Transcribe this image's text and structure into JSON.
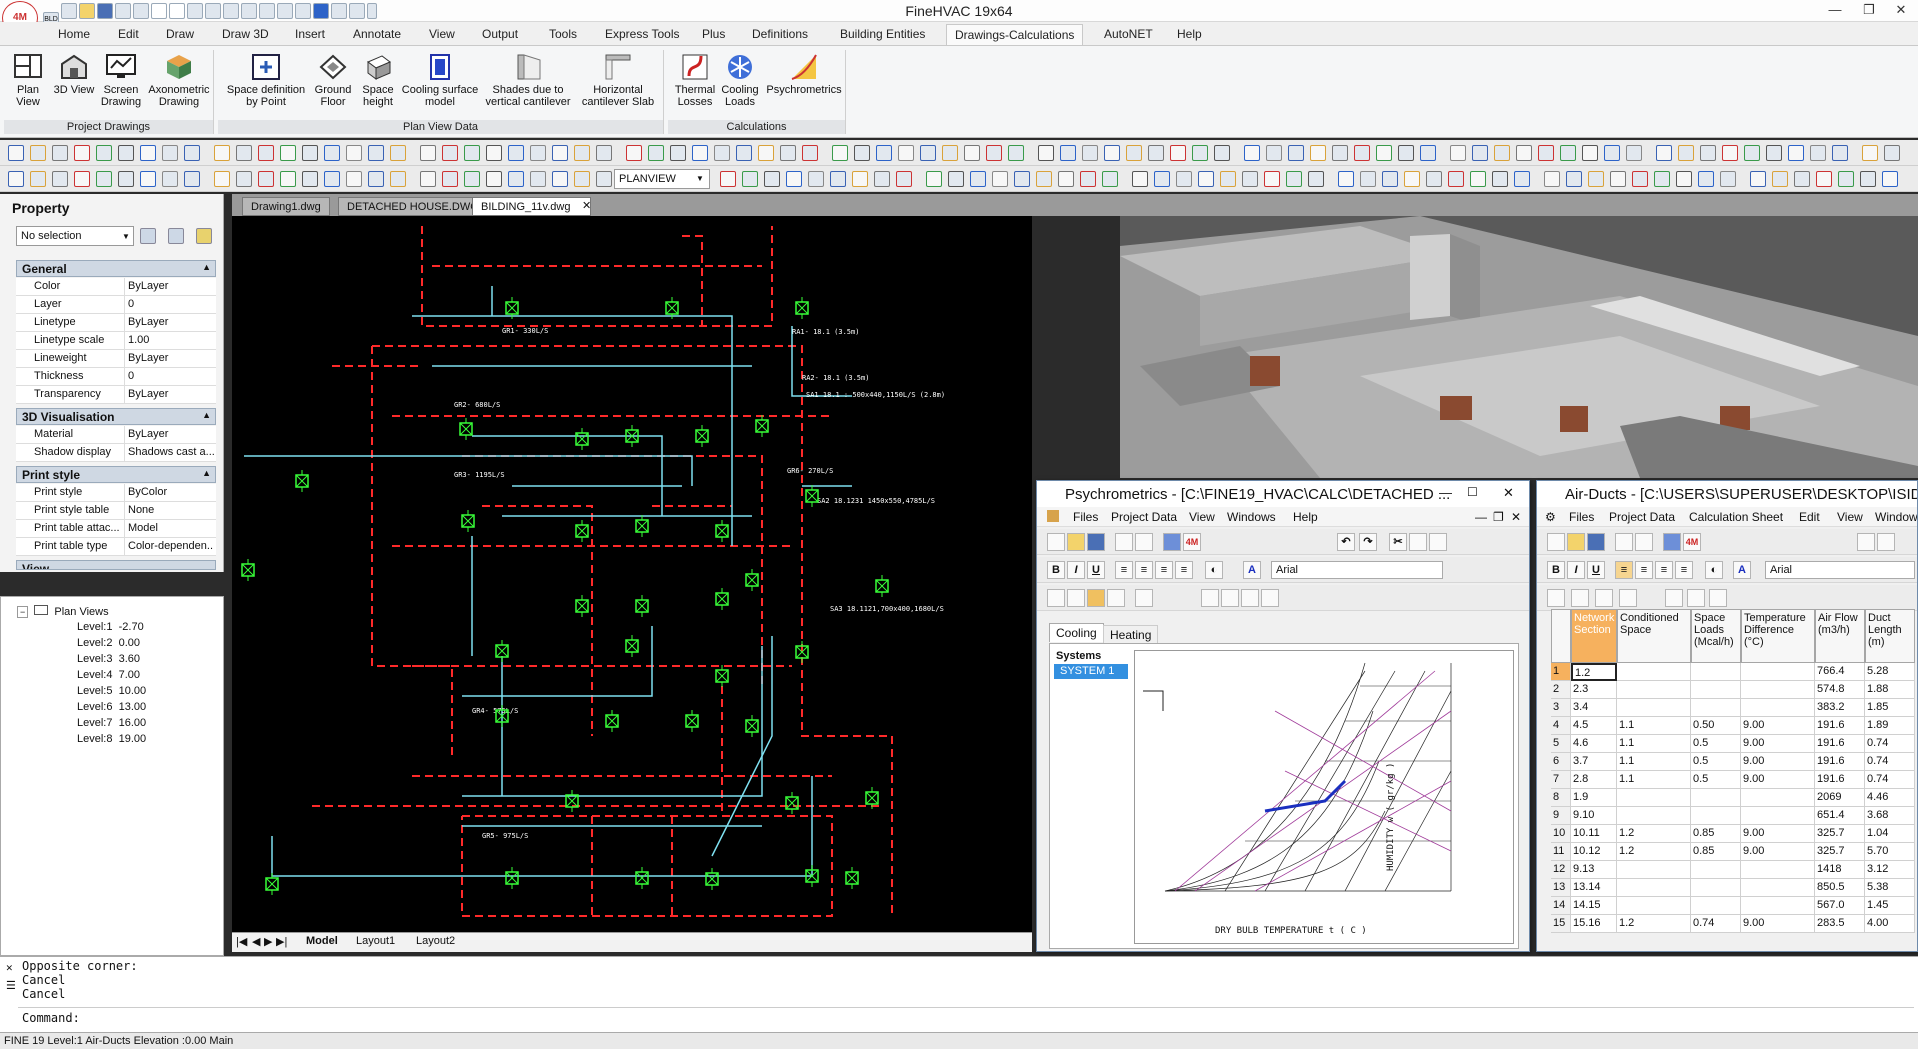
{
  "app": {
    "title": "FineHVAC 19x64",
    "logo": "4M",
    "qat_label": "BLD"
  },
  "ribbon_tabs": [
    "Home",
    "Edit",
    "Draw",
    "Draw 3D",
    "Insert",
    "Annotate",
    "View",
    "Output",
    "Tools",
    "Express Tools",
    "Plus",
    "Definitions",
    "Building Entities",
    "Drawings-Calculations",
    "AutoNET",
    "Help"
  ],
  "ribbon": {
    "groups": [
      {
        "label": "Project Drawings",
        "buttons": [
          "Plan View",
          "3D View",
          "Screen Drawing",
          "Axonometric Drawing"
        ]
      },
      {
        "label": "Plan View Data",
        "buttons": [
          "Space definition by Point",
          "Ground Floor",
          "Space height",
          "Cooling surface model",
          "Shades due to vertical cantilever",
          "Horizontal cantilever Slab"
        ]
      },
      {
        "label": "Calculations",
        "buttons": [
          "Thermal Losses",
          "Cooling Loads",
          "Psychrometrics"
        ]
      }
    ]
  },
  "toolbar": {
    "planview_value": "PLANVIEW"
  },
  "doc_tabs": [
    "Drawing1.dwg",
    "DETACHED HOUSE.DWG",
    "BILDING_11v.dwg"
  ],
  "property_panel": {
    "title": "Property",
    "selection": "No selection",
    "sections": [
      {
        "name": "General",
        "rows": [
          [
            "Color",
            "ByLayer"
          ],
          [
            "Layer",
            "0"
          ],
          [
            "Linetype",
            "ByLayer"
          ],
          [
            "Linetype scale",
            "1.00"
          ],
          [
            "Lineweight",
            "ByLayer"
          ],
          [
            "Thickness",
            "0"
          ],
          [
            "Transparency",
            "ByLayer"
          ]
        ]
      },
      {
        "name": "3D Visualisation",
        "rows": [
          [
            "Material",
            "ByLayer"
          ],
          [
            "Shadow display",
            "Shadows cast a..."
          ]
        ]
      },
      {
        "name": "Print style",
        "rows": [
          [
            "Print style",
            "ByColor"
          ],
          [
            "Print style table",
            "None"
          ],
          [
            "Print table attac...",
            "Model"
          ],
          [
            "Print table type",
            "Color-dependen..."
          ]
        ]
      }
    ],
    "collapsed_section": "View"
  },
  "plan_views": {
    "root": "Plan Views",
    "levels": [
      [
        "Level:1",
        "-2.70"
      ],
      [
        "Level:2",
        "0.00"
      ],
      [
        "Level:3",
        "3.60"
      ],
      [
        "Level:4",
        "7.00"
      ],
      [
        "Level:5",
        "10.00"
      ],
      [
        "Level:6",
        "13.00"
      ],
      [
        "Level:7",
        "16.00"
      ],
      [
        "Level:8",
        "19.00"
      ]
    ]
  },
  "layout_tabs": [
    "Model",
    "Layout1",
    "Layout2"
  ],
  "cad_labels": {
    "ra": "RA1- 18.1 (3.5m)",
    "ra2": "RA2- 18.1 (3.5m)",
    "sa1": "SA1 18.1 : 500x440,1150L/S (2.8m)",
    "sa2": "SA2 18.1231 1450x550,4785L/S",
    "sa3": "SA3 18.1121,700x400,1680L/S",
    "g1": "GR1- 330L/S",
    "g2": "GR2- 680L/S",
    "g3": "GR3- 1195L/S",
    "g4": "GR4- 575L/S",
    "g5": "GR5- 975L/S",
    "g6": "GR6- 270L/S"
  },
  "psychrometrics": {
    "title": "Psychrometrics - [C:\\FINE19_HVAC\\CALC\\DETACHED ...",
    "menu": [
      "Files",
      "Project Data",
      "View",
      "Windows",
      "Help"
    ],
    "font": "Arial",
    "tabs": [
      "Cooling",
      "Heating"
    ],
    "systems_label": "Systems",
    "system": "SYSTEM 1",
    "xlabel": "DRY BULB TEMPERATURE  t ( C )",
    "ylabel": "HUMIDITY w ( gr/kg )"
  },
  "air_ducts": {
    "title": "Air-Ducts - [C:\\USERS\\SUPERUSER\\DESKTOP\\ISIDOR",
    "menu": [
      "Files",
      "Project Data",
      "Calculation Sheet",
      "Edit",
      "View",
      "Window"
    ],
    "font": "Arial",
    "columns": [
      "Network Section",
      "Conditioned Space",
      "Space Loads (Mcal/h)",
      "Temperature Difference (°C)",
      "Air Flow (m3/h)",
      "Duct Length (m)"
    ],
    "rows": [
      [
        "1",
        "1.2",
        "",
        "",
        "",
        "766.4",
        "5.28"
      ],
      [
        "2",
        "2.3",
        "",
        "",
        "",
        "574.8",
        "1.88"
      ],
      [
        "3",
        "3.4",
        "",
        "",
        "",
        "383.2",
        "1.85"
      ],
      [
        "4",
        "4.5",
        "1.1",
        "0.50",
        "9.00",
        "191.6",
        "1.89"
      ],
      [
        "5",
        "4.6",
        "1.1",
        "0.5",
        "9.00",
        "191.6",
        "0.74"
      ],
      [
        "6",
        "3.7",
        "1.1",
        "0.5",
        "9.00",
        "191.6",
        "0.74"
      ],
      [
        "7",
        "2.8",
        "1.1",
        "0.5",
        "9.00",
        "191.6",
        "0.74"
      ],
      [
        "8",
        "1.9",
        "",
        "",
        "",
        "2069",
        "4.46"
      ],
      [
        "9",
        "9.10",
        "",
        "",
        "",
        "651.4",
        "3.68"
      ],
      [
        "10",
        "10.11",
        "1.2",
        "0.85",
        "9.00",
        "325.7",
        "1.04"
      ],
      [
        "11",
        "10.12",
        "1.2",
        "0.85",
        "9.00",
        "325.7",
        "5.70"
      ],
      [
        "12",
        "9.13",
        "",
        "",
        "",
        "1418",
        "3.12"
      ],
      [
        "13",
        "13.14",
        "",
        "",
        "",
        "850.5",
        "5.38"
      ],
      [
        "14",
        "14.15",
        "",
        "",
        "",
        "567.0",
        "1.45"
      ],
      [
        "15",
        "15.16",
        "1.2",
        "0.74",
        "9.00",
        "283.5",
        "4.00"
      ]
    ]
  },
  "command": {
    "lines": [
      "Opposite corner:",
      "Cancel",
      "Cancel"
    ],
    "prompt": "Command:"
  },
  "status": "FINE 19 Level:1  Air-Ducts Elevation :0.00 Main",
  "colors": {
    "accent": "#f6b15e",
    "cad_bg": "#000000",
    "wall": "#ff2a2a",
    "duct": "#7fe0f0",
    "diffuser": "#39ff39"
  }
}
